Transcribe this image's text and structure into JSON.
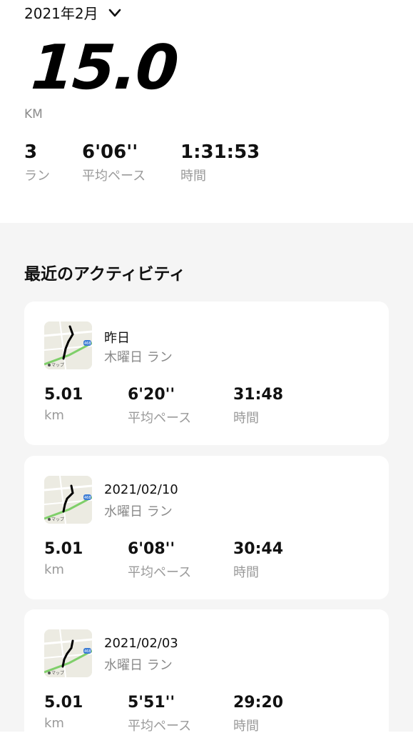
{
  "header": {
    "month_label": "2021年2月",
    "total_distance": "15.0",
    "distance_unit": "KM",
    "stats": [
      {
        "value": "3",
        "label": "ラン"
      },
      {
        "value": "6'06''",
        "label": "平均ペース"
      },
      {
        "value": "1:31:53",
        "label": "時間"
      }
    ]
  },
  "activities": {
    "title": "最近のアクティビティ",
    "items": [
      {
        "date": "昨日",
        "type": "木曜日 ラン",
        "distance": "5.01",
        "distance_unit": "km",
        "pace": "6'20''",
        "pace_label": "平均ペース",
        "time": "31:48",
        "time_label": "時間",
        "map_label": "マップ",
        "road_number": "468"
      },
      {
        "date": "2021/02/10",
        "type": "水曜日 ラン",
        "distance": "5.01",
        "distance_unit": "km",
        "pace": "6'08''",
        "pace_label": "平均ペース",
        "time": "30:44",
        "time_label": "時間",
        "map_label": "マップ",
        "road_number": "468"
      },
      {
        "date": "2021/02/03",
        "type": "水曜日 ラン",
        "distance": "5.01",
        "distance_unit": "km",
        "pace": "5'51''",
        "pace_label": "平均ペース",
        "time": "29:20",
        "time_label": "時間",
        "map_label": "マップ",
        "road_number": "468"
      }
    ]
  },
  "colors": {
    "map_road": "#7fcf6a",
    "map_route": "#000000",
    "route_badge": "#3a7bd5"
  }
}
